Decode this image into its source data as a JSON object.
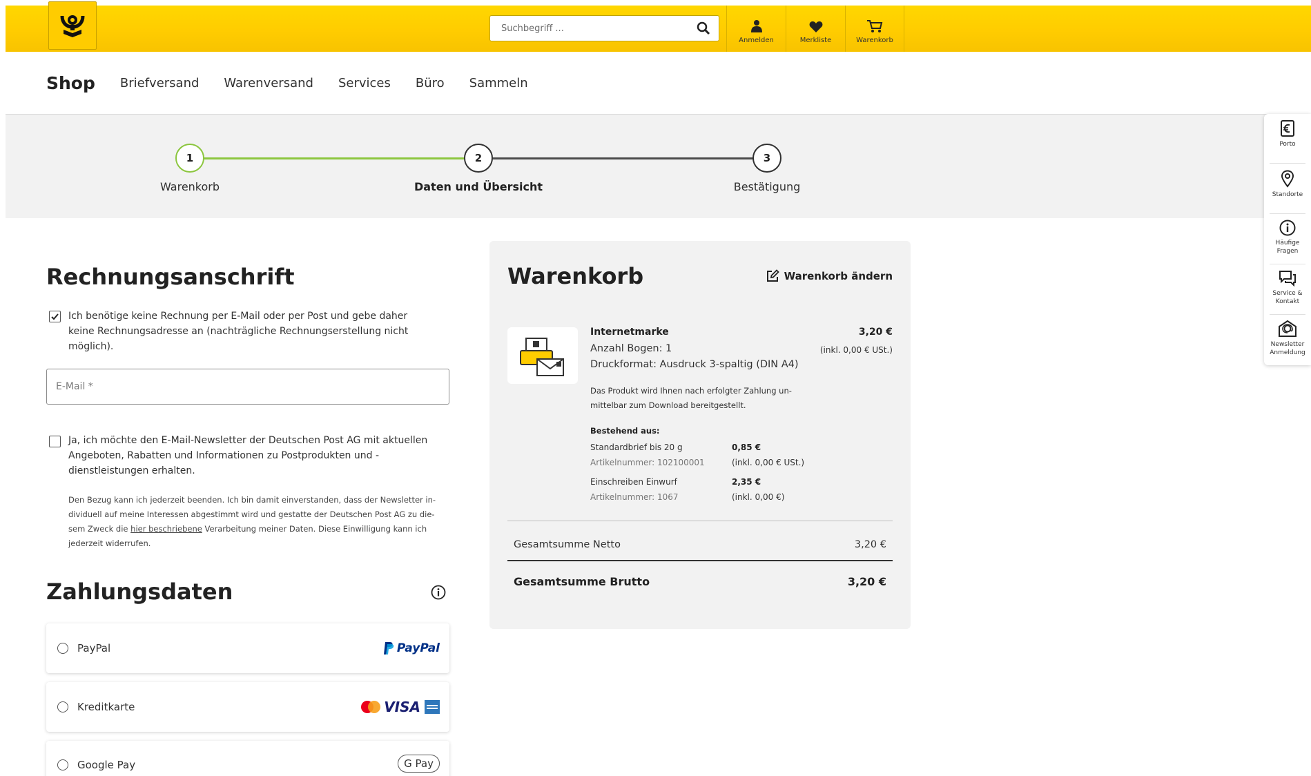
{
  "header": {
    "search_placeholder": "Suchbegriff ...",
    "buttons": [
      {
        "label": "Anmelden",
        "icon": "person-icon"
      },
      {
        "label": "Merkliste",
        "icon": "heart-icon"
      },
      {
        "label": "Warenkorb",
        "icon": "cart-icon"
      }
    ]
  },
  "nav": {
    "shop": "Shop",
    "items": [
      "Briefversand",
      "Warenversand",
      "Services",
      "Büro",
      "Sammeln"
    ]
  },
  "stepper": {
    "steps": [
      {
        "num": "1",
        "label": "Warenkorb",
        "state": "done"
      },
      {
        "num": "2",
        "label": "Daten und Übersicht",
        "state": "current"
      },
      {
        "num": "3",
        "label": "Bestätigung",
        "state": "todo"
      }
    ],
    "accent": "#8cc63f"
  },
  "billing": {
    "title": "Rechnungsanschrift",
    "no_invoice_checked": true,
    "no_invoice_text": [
      "Ich benötige keine Rechnung per E-Mail oder per Post und gebe daher",
      "keine Rechnungsadresse an (nachträgliche Rechnungserstellung nicht",
      "möglich)."
    ],
    "email_placeholder": "E-Mail *",
    "newsletter_checked": false,
    "newsletter_text": [
      "Ja, ich möchte den E-Mail-Newsletter der Deutschen Post AG mit aktuellen",
      "Angeboten, Rabatten und Informationen zu Postprodukten und -",
      "dienstleistungen erhalten."
    ],
    "consent_lines": [
      "Den Bezug kann ich jederzeit beenden. Ich bin damit einverstanden, dass der Newsletter in-",
      "dividuell auf meine Interessen abgestimmt wird und gestatte der Deutschen Post AG zu die-"
    ],
    "consent_line3_pre": "sem Zweck die ",
    "consent_link": "hier beschriebene",
    "consent_line3_post": " Verarbeitung meiner Daten. Diese Einwilligung kann ich",
    "consent_line4": "jederzeit widerrufen."
  },
  "payment": {
    "title": "Zahlungsdaten",
    "info_icon": "info-icon",
    "methods": [
      {
        "label": "PayPal",
        "brand": "PayPal"
      },
      {
        "label": "Kreditkarte",
        "brand": "VISA"
      },
      {
        "label": "Google Pay",
        "brand": "G Pay"
      }
    ]
  },
  "cart": {
    "title": "Warenkorb",
    "edit_label": "Warenkorb ändern",
    "item": {
      "name": "Internetmarke",
      "price": "3,20 €",
      "vat": "(inkl. 0,00 € USt.)",
      "sheets": "Anzahl Bogen:  1",
      "format": "Druckformat:  Ausdruck 3-spaltig (DIN A4)",
      "note_lines": [
        "Das Produkt wird Ihnen nach erfolgter Zahlung un-",
        "mittelbar zum Download bereitgestellt."
      ],
      "components_title": "Bestehend aus:",
      "components": [
        {
          "name": "Standardbrief bis 20 g",
          "article": "Artikelnummer: 102100001",
          "price": "0,85 €",
          "vat": "(inkl. 0,00 € USt.)"
        },
        {
          "name": "Einschreiben Einwurf",
          "article": "Artikelnummer: 1067",
          "price": "2,35 €",
          "vat": "(inkl. 0,00 €)"
        }
      ]
    },
    "net_label": "Gesamtsumme Netto",
    "net_value": "3,20 €",
    "gross_label": "Gesamtsumme Brutto",
    "gross_value": "3,20 €"
  },
  "sidebar": [
    {
      "label": "Porto",
      "icon": "euro-icon"
    },
    {
      "label": "Standorte",
      "icon": "location-pin-icon"
    },
    {
      "label": "Häufige Fragen",
      "icon": "info-icon"
    },
    {
      "label": "Service & Kontakt",
      "icon": "chat-icon"
    },
    {
      "label": "Newsletter Anmeldung",
      "icon": "newsletter-icon"
    }
  ],
  "colors": {
    "brand_yellow": "#ffcc00",
    "panel_bg": "#f2f2f2",
    "text": "#323232"
  }
}
